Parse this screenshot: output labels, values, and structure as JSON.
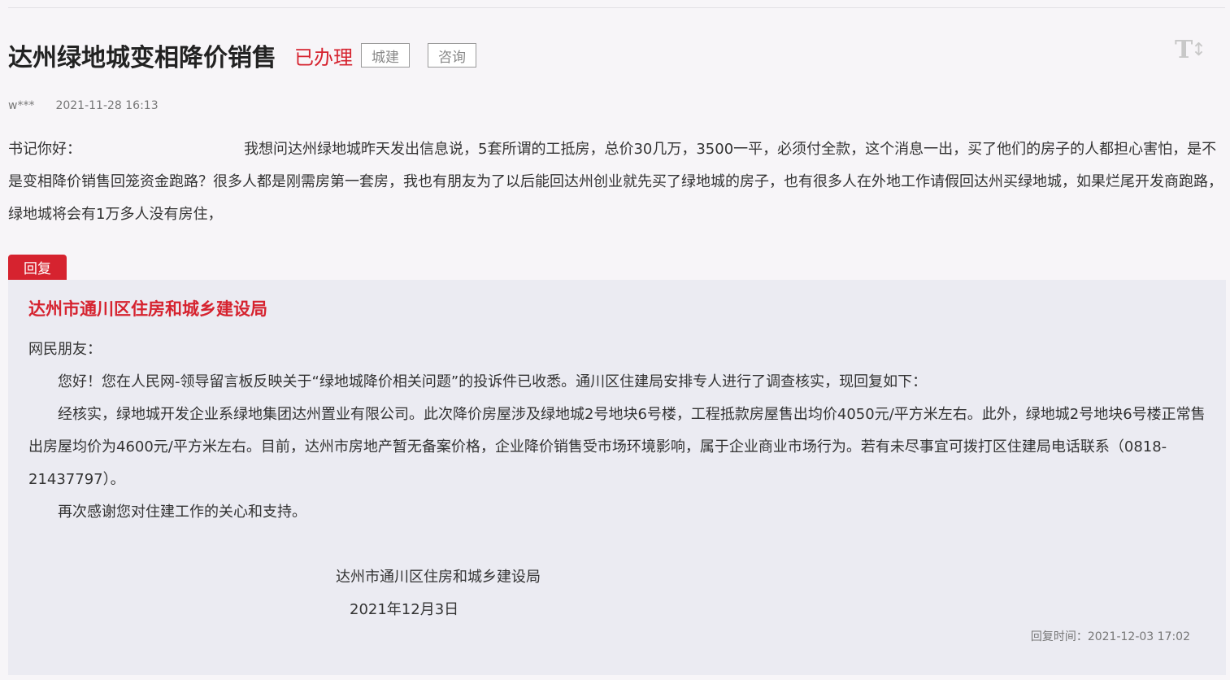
{
  "post": {
    "title": "达州绿地城变相降价销售",
    "status": "已办理",
    "tags": [
      "城建",
      "咨询"
    ],
    "author": "w***",
    "date": "2021-11-28 16:13",
    "font_toggle_icon": "text-size-icon",
    "question_salutation": "书记你好：",
    "question_body": "我想问达州绿地城昨天发出信息说，5套所谓的工抵房，总价30几万，3500一平，必须付全款，这个消息一出，买了他们的房子的人都担心害怕，是不是变相降价销售回笼资金跑路？很多人都是刚需房第一套房，我也有朋友为了以后能回达州创业就先买了绿地城的房子，也有很多人在外地工作请假回达州买绿地城，如果烂尾开发商跑路，绿地城将会有1万多人没有房住，"
  },
  "reply": {
    "tab_label": "回复",
    "org": "达州市通川区住房和城乡建设局",
    "greeting": "网民朋友：",
    "paragraphs": [
      "您好！您在人民网-领导留言板反映关于“绿地城降价相关问题”的投诉件已收悉。通川区住建局安排专人进行了调查核实，现回复如下：",
      "经核实，绿地城开发企业系绿地集团达州置业有限公司。此次降价房屋涉及绿地城2号地块6号楼，工程抵款房屋售出均价4050元/平方米左右。此外，绿地城2号地块6号楼正常售出房屋均价为4600元/平方米左右。目前，达州市房地产暂无备案价格，企业降价销售受市场环境影响，属于企业商业市场行为。若有未尽事宜可拨打区住建局电话联系（0818-21437797）。",
      "再次感谢您对住建工作的关心和支持。"
    ],
    "signature_org": "达州市通川区住房和城乡建设局",
    "signature_date": "2021年12月3日",
    "reply_time": "回复时间：2021-12-03 17:02"
  },
  "colors": {
    "accent_red": "#d6232f",
    "background": "#f7f5f8",
    "reply_background": "#ebebf2"
  }
}
